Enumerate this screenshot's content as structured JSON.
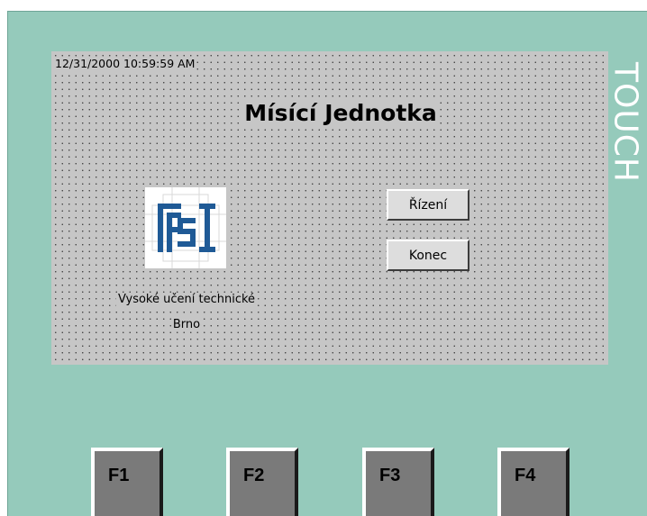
{
  "screen": {
    "datetime": "12/31/2000 10:59:59 AM",
    "title": "Mísící Jednotka",
    "brand_side_label": "TOUCH",
    "logo_icon": "fsi-logo-icon",
    "institution_line1": "Vysoké učení technické",
    "institution_line2": "Brno",
    "buttons": {
      "control_label": "Řízení",
      "exit_label": "Konec"
    }
  },
  "function_keys": [
    "F1",
    "F2",
    "F3",
    "F4"
  ],
  "colors": {
    "panel": "#95cabb",
    "screen": "#c6c6c6",
    "logo_blue": "#1f5a96",
    "fkey": "#7a7a7a"
  }
}
